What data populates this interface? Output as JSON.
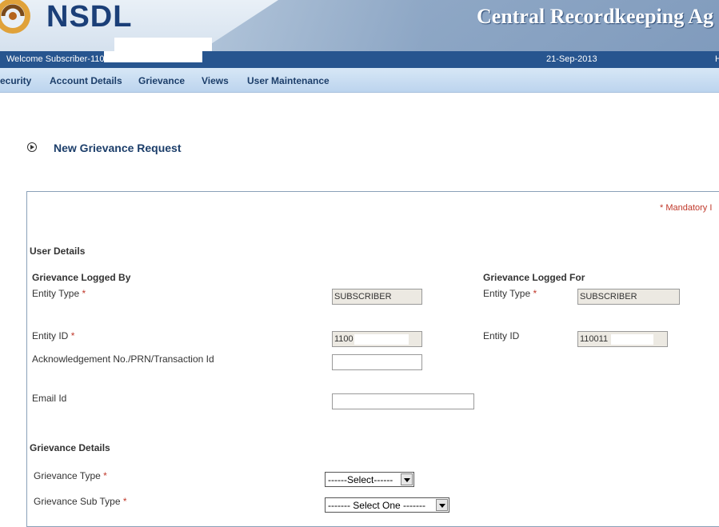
{
  "header": {
    "brand": "NSDL",
    "tagline": "Central Recordkeeping Ag",
    "welcome": "Welcome Subscriber-110",
    "date": "21-Sep-2013",
    "right_text": "H"
  },
  "menu": {
    "items": [
      {
        "label": "ecurity"
      },
      {
        "label": "Account Details"
      },
      {
        "label": "Grievance"
      },
      {
        "label": "Views"
      },
      {
        "label": "User Maintenance"
      }
    ]
  },
  "page": {
    "title": "New Grievance Request",
    "mandatory_note": "* Mandatory I"
  },
  "user_details": {
    "heading": "User Details",
    "logged_by": {
      "heading": "Grievance Logged By",
      "entity_type_label": "Entity Type",
      "entity_type_value": "SUBSCRIBER",
      "entity_id_label": "Entity ID",
      "entity_id_value": "1100",
      "ack_label": "Acknowledgement No./PRN/Transaction Id",
      "ack_value": "",
      "email_label": "Email Id",
      "email_value": ""
    },
    "logged_for": {
      "heading": "Grievance Logged For",
      "entity_type_label": "Entity Type",
      "entity_type_value": "SUBSCRIBER",
      "entity_id_label": "Entity ID",
      "entity_id_value": "110011"
    }
  },
  "grievance_details": {
    "heading": "Grievance Details",
    "type_label": "Grievance Type",
    "type_selected": "------Select------",
    "subtype_label": "Grievance Sub Type",
    "subtype_selected": "------- Select One -------"
  },
  "required_mark": "*",
  "colors": {
    "brand_blue": "#1b3f78",
    "welcome_bar": "#27558f",
    "required_red": "#c0392b"
  }
}
